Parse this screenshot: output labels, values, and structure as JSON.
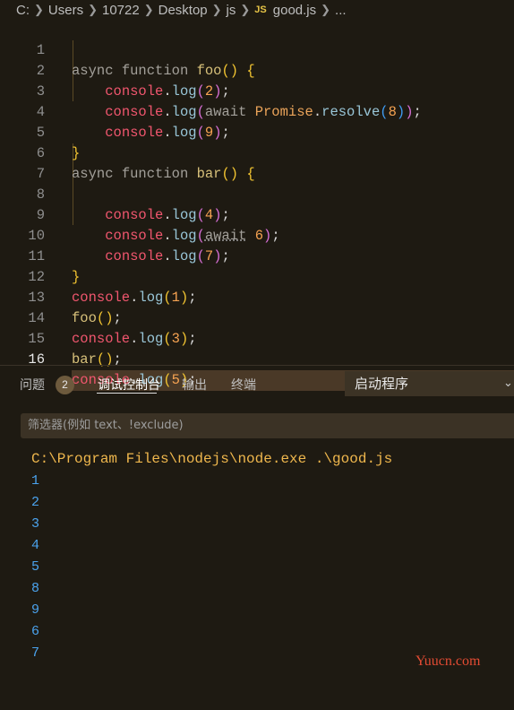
{
  "breadcrumb": {
    "items": [
      "C:",
      "Users",
      "10722",
      "Desktop",
      "js"
    ],
    "js_badge": "JS",
    "file": "good.js",
    "more": "..."
  },
  "editor": {
    "current_line": 16,
    "lines": [
      {
        "n": "1"
      },
      {
        "n": "2"
      },
      {
        "n": "3"
      },
      {
        "n": "4"
      },
      {
        "n": "5"
      },
      {
        "n": "6"
      },
      {
        "n": "7"
      },
      {
        "n": "8"
      },
      {
        "n": "9"
      },
      {
        "n": "10"
      },
      {
        "n": "11"
      },
      {
        "n": "12"
      },
      {
        "n": "13"
      },
      {
        "n": "14"
      },
      {
        "n": "15"
      },
      {
        "n": "16"
      }
    ],
    "tokens": {
      "async": "async",
      "function": "function",
      "foo": "foo",
      "bar": "bar",
      "console": "console",
      "log": "log",
      "await": "await",
      "Promise": "Promise",
      "resolve": "resolve",
      "v1": "1",
      "v2": "2",
      "v3": "3",
      "v4": "4",
      "v5": "5",
      "v6": "6",
      "v7": "7",
      "v8": "8",
      "v9": "9"
    }
  },
  "panel": {
    "tabs": [
      {
        "label": "问题",
        "badge": "2"
      },
      {
        "label": "调试控制台",
        "active": true
      },
      {
        "label": "输出"
      },
      {
        "label": "终端"
      }
    ],
    "launch_select": "启动程序",
    "filter_placeholder": "筛选器(例如 text、!exclude)"
  },
  "console": {
    "command": "C:\\Program Files\\nodejs\\node.exe .\\good.js",
    "output": [
      "1",
      "2",
      "3",
      "4",
      "5",
      "8",
      "9",
      "6",
      "7"
    ]
  },
  "watermark": "Yuucn.com",
  "colors": {
    "background": "#1e1a12",
    "current_line": "#4a3927",
    "keyword": "#a3a09a",
    "console_obj": "#f0566e",
    "number": "#f6a352",
    "output": "#4ba3ee",
    "command": "#efb74d"
  }
}
